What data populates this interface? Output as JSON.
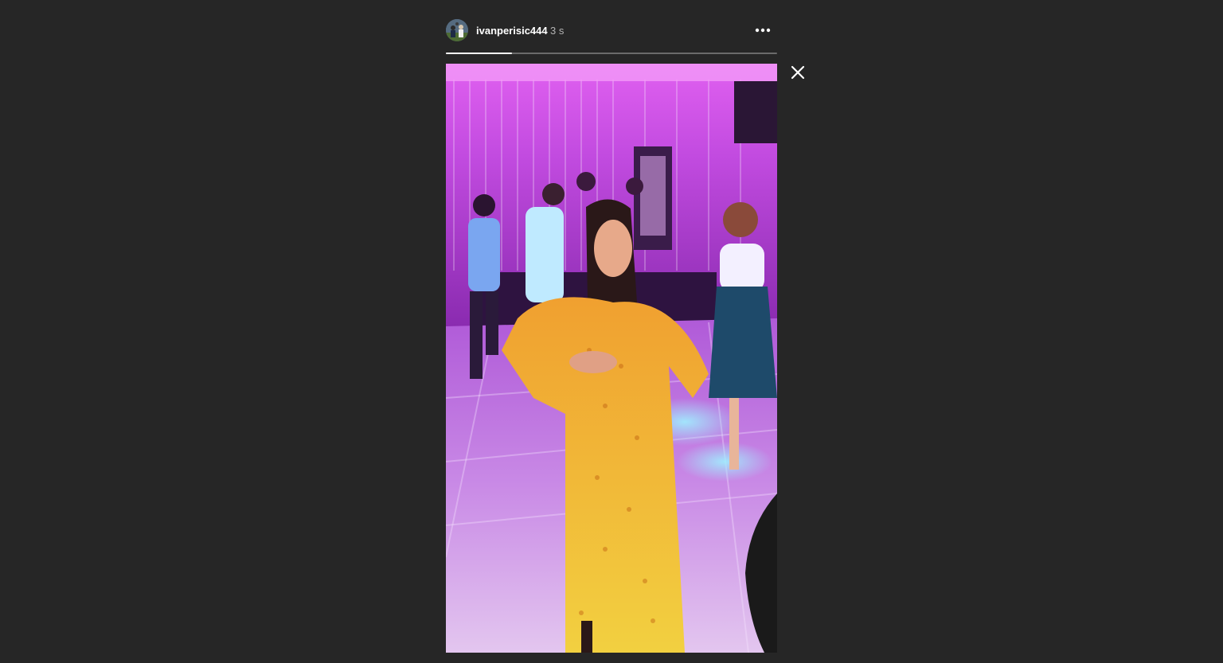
{
  "story": {
    "username": "ivanperisic444",
    "timestamp": "3 s",
    "progress": 0.2,
    "avatar_icon": "user-avatar",
    "more_icon": "more-horizontal-icon",
    "media_description_icon": "video-frame"
  },
  "controls": {
    "close_icon": "close-icon"
  },
  "colors": {
    "background": "#262626",
    "progress_fill": "#ffffff",
    "progress_track": "#6b6b6b",
    "username": "#ffffff",
    "timestamp": "#b3b3b3"
  }
}
